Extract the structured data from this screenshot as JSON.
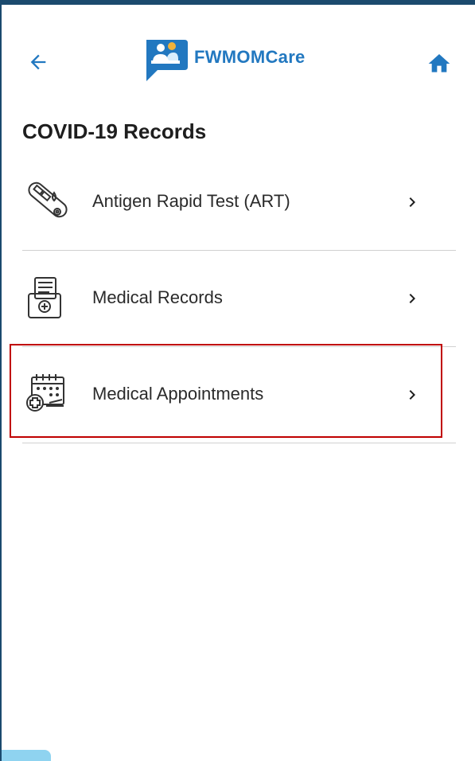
{
  "header": {
    "app_name": "FWMOMCare",
    "back_icon": "arrow-left-icon",
    "home_icon": "home-icon",
    "brand_color": "#2278c0"
  },
  "page": {
    "title": "COVID-19 Records"
  },
  "menu": {
    "items": [
      {
        "label": "Antigen Rapid Test (ART)",
        "icon": "test-kit-icon"
      },
      {
        "label": "Medical Records",
        "icon": "medical-record-icon"
      },
      {
        "label": "Medical Appointments",
        "icon": "calendar-medical-icon"
      }
    ]
  },
  "highlight_color": "#c00000"
}
